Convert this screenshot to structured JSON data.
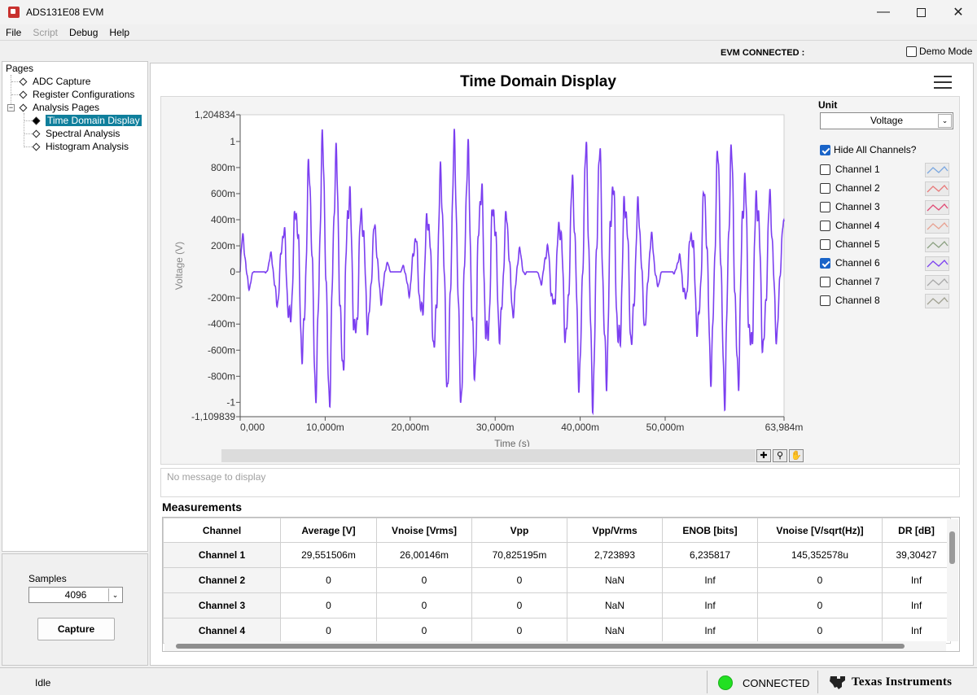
{
  "window": {
    "title": "ADS131E08 EVM"
  },
  "menu": [
    "File",
    "Script",
    "Debug",
    "Help"
  ],
  "header": {
    "evm_status": "EVM CONNECTED :",
    "demo_mode": "Demo Mode"
  },
  "sidebar": {
    "root": "Pages",
    "items": [
      {
        "label": "ADC Capture"
      },
      {
        "label": "Register Configurations"
      },
      {
        "label": "Analysis Pages"
      },
      {
        "label": "Time Domain Display"
      },
      {
        "label": "Spectral Analysis"
      },
      {
        "label": "Histogram Analysis"
      }
    ],
    "expand_symbol": "−"
  },
  "samples": {
    "label": "Samples",
    "value": "4096"
  },
  "capture": {
    "label": "Capture"
  },
  "main": {
    "title": "Time Domain Display",
    "unit_label": "Unit",
    "unit_value": "Voltage",
    "hide_all": "Hide All Channels?",
    "channels": [
      {
        "name": "Channel 1",
        "checked": false,
        "color": "#7aa7e0"
      },
      {
        "name": "Channel 2",
        "checked": false,
        "color": "#e87878"
      },
      {
        "name": "Channel 3",
        "checked": false,
        "color": "#e04a74"
      },
      {
        "name": "Channel 4",
        "checked": false,
        "color": "#e8a090"
      },
      {
        "name": "Channel 5",
        "checked": false,
        "color": "#8aa080"
      },
      {
        "name": "Channel 6",
        "checked": true,
        "color": "#7b3ff0"
      },
      {
        "name": "Channel 7",
        "checked": false,
        "color": "#a8a8a8"
      },
      {
        "name": "Channel 8",
        "checked": false,
        "color": "#a0a090"
      }
    ],
    "message": "No message to display"
  },
  "chart_data": {
    "type": "line",
    "title": "Time Domain Display",
    "xlabel": "Time (s)",
    "ylabel": "Voltage (V)",
    "xlim": [
      0,
      63.984
    ],
    "ylim": [
      -1.109839,
      1.204834
    ],
    "xticks": [
      "0,000",
      "10,000m",
      "20,000m",
      "30,000m",
      "40,000m",
      "50,000m",
      "63,984m"
    ],
    "xtick_values": [
      0,
      10,
      20,
      30,
      40,
      50,
      63.984
    ],
    "yticks": [
      "1,204834",
      "1",
      "800m",
      "600m",
      "400m",
      "200m",
      "0",
      "-200m",
      "-400m",
      "-600m",
      "-800m",
      "-1",
      "-1,109839"
    ],
    "ytick_values": [
      1.204834,
      1,
      0.8,
      0.6,
      0.4,
      0.2,
      0,
      -0.2,
      -0.4,
      -0.6,
      -0.8,
      -1,
      -1.109839
    ],
    "grid": false,
    "series": [
      {
        "name": "Channel 6",
        "color": "#7b3ff0"
      }
    ]
  },
  "measurements": {
    "title": "Measurements",
    "columns": [
      "Channel",
      "Average [V]",
      "Vnoise [Vrms]",
      "Vpp",
      "Vpp/Vrms",
      "ENOB [bits]",
      "Vnoise [V/sqrt(Hz)]",
      "DR [dB]"
    ],
    "rows": [
      [
        "Channel 1",
        "29,551506m",
        "26,00146m",
        "70,825195m",
        "2,723893",
        "6,235817",
        "145,352578u",
        "39,30427"
      ],
      [
        "Channel 2",
        "0",
        "0",
        "0",
        "NaN",
        "Inf",
        "0",
        "Inf"
      ],
      [
        "Channel 3",
        "0",
        "0",
        "0",
        "NaN",
        "Inf",
        "0",
        "Inf"
      ],
      [
        "Channel 4",
        "0",
        "0",
        "0",
        "NaN",
        "Inf",
        "0",
        "Inf"
      ]
    ]
  },
  "status": {
    "state": "Idle",
    "connection": "CONNECTED",
    "brand": "Texas Instruments",
    "conn_color": "#22e022"
  }
}
